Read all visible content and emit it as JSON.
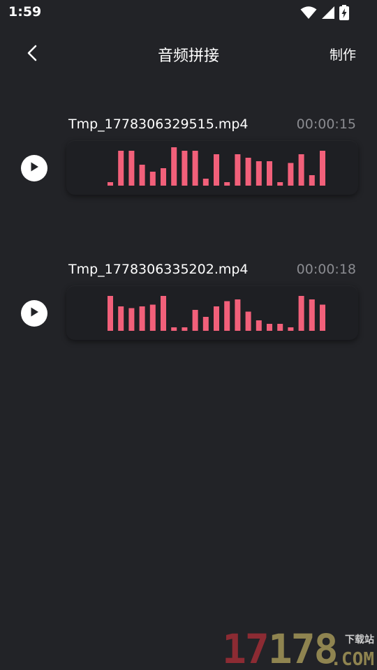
{
  "status_bar": {
    "time": "1:59",
    "icons": [
      "wifi-icon",
      "cellular-signal-icon",
      "battery-charging-icon"
    ]
  },
  "header": {
    "back_icon": "chevron-left-icon",
    "title": "音频拼接",
    "action_label": "制作"
  },
  "colors": {
    "background": "#222327",
    "panel": "#1e1f23",
    "wave_bar": "#f2607a",
    "duration_text": "#8a8b90"
  },
  "audio_items": [
    {
      "file_name": "Tmp_1778306329515.mp4",
      "duration": "00:00:15",
      "play_icon": "play-icon",
      "waveform_levels": [
        0.1,
        1.0,
        1.0,
        0.6,
        0.4,
        0.5,
        1.1,
        1.0,
        1.0,
        0.2,
        0.9,
        0.1,
        0.9,
        0.8,
        0.7,
        0.7,
        0.1,
        0.65,
        0.9,
        0.3,
        1.0
      ]
    },
    {
      "file_name": "Tmp_1778306335202.mp4",
      "duration": "00:00:18",
      "play_icon": "play-icon",
      "waveform_levels": [
        1.0,
        0.7,
        0.65,
        0.7,
        0.75,
        1.0,
        0.1,
        0.1,
        0.6,
        0.4,
        0.7,
        0.85,
        0.9,
        0.55,
        0.3,
        0.2,
        0.2,
        0.1,
        1.0,
        0.9,
        0.75
      ]
    }
  ],
  "watermark": {
    "number_a": "17",
    "number_b": "178",
    "sub": "下载站",
    "domain": ".COM"
  }
}
